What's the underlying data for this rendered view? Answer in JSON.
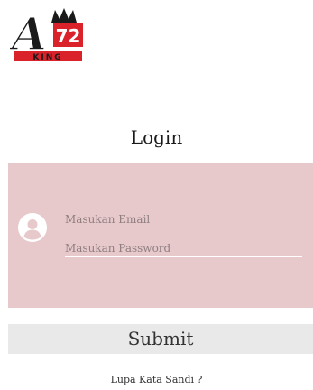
{
  "logo": {
    "mark": "A",
    "number": "72",
    "subtitle": "KING",
    "colors": {
      "letter": "#1a1a1a",
      "red": "#d9222a",
      "crown": "#1a1a1a"
    }
  },
  "login": {
    "title": "Login"
  },
  "form": {
    "panel_color": "#e7c9cb",
    "avatar_icon": "user-avatar-icon",
    "email_placeholder": "Masukan Email",
    "password_placeholder": "Masukan Password"
  },
  "actions": {
    "submit_label": "Submit",
    "forgot_label": "Lupa Kata Sandi ?"
  }
}
